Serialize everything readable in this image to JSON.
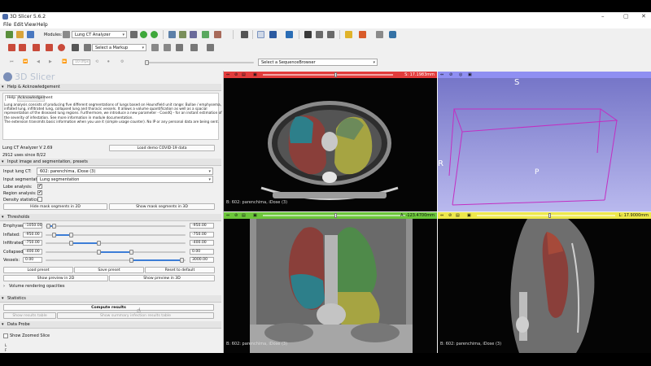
{
  "window": {
    "title": "3D Slicer 5.6.2",
    "controls": [
      "–",
      "▢",
      "✕"
    ]
  },
  "menu": [
    "File",
    "Edit",
    "View",
    "Help"
  ],
  "toolbar": {
    "modules_label": "Modules:",
    "module_selected": "Lung CT Analyzer",
    "markup_placeholder": "Select a Markup",
    "sequence_placeholder": "Select a SequenceBrowser",
    "fps": "10.0fps"
  },
  "logo_text": "3D Slicer",
  "help": {
    "section_title": "Help & Acknowledgement",
    "tabs": [
      "Help",
      "Acknowledgement"
    ],
    "text_lines": [
      "Lung analysis consists of producing five different segmentations of lungs based on Hounsfield unit range: Bullae / emphysema,",
      "inflated lung, infiltrated lung, collapsed lung and thoracic vessels. It allows a volume quantification as well as a spacial",
      "representation of the diseased lung regions. Furthermore, we introduce a new parameter - CovidQ - for an instant estimation of",
      "the severity of infestation. See more information in module documentation.",
      "The extension transmits basic information when you use it (simple usage counter). No IP or any personal data are being sent."
    ],
    "doc_link": "module documentation"
  },
  "version": "Lung CT Analyzer V 2.69",
  "load_demo_button": "Load demo COVID-19 data",
  "uses": "2912 uses since 8/22",
  "input_section": {
    "title": "Input image and segmentation, presets",
    "input_lung_ct_label": "Input lung CT:",
    "input_lung_ct_value": "602: parenchima, iDose (3)",
    "input_seg_label": "Input segmentation:",
    "input_seg_value": "Lung segmentation",
    "lobe_label": "Lobe analysis:",
    "region_label": "Region analysis:",
    "density_label": "Density statistics:",
    "lobe_checked": "✔",
    "region_checked": "✔",
    "hide_button": "Hide mask segments in 2D",
    "show3d_button": "Show mask segments in 3D"
  },
  "thresholds": {
    "title": "Thresholds",
    "rows": [
      {
        "label": "Emphysema:",
        "min": "-1050.00",
        "max": "-950.00",
        "range": [
          0.02,
          0.06
        ]
      },
      {
        "label": "Inflated:",
        "min": "-950.00",
        "max": "-750.00",
        "range": [
          0.06,
          0.18
        ]
      },
      {
        "label": "Infiltrated:",
        "min": "-750.00",
        "max": "-400.00",
        "range": [
          0.18,
          0.38
        ]
      },
      {
        "label": "Collapsed:",
        "min": "-400.00",
        "max": "0.00",
        "range": [
          0.38,
          0.61
        ]
      },
      {
        "label": "Vessels:",
        "min": "0.00",
        "max": "3000.00",
        "range": [
          0.61,
          0.97
        ]
      }
    ],
    "load_preset": "Load preset",
    "save_preset": "Save preset",
    "reset_default": "Reset to default",
    "preview2d": "Show preview in 2D",
    "preview3d": "Show preview in 3D"
  },
  "volume_rendering": "Volume rendering opacities",
  "statistics": {
    "title": "Statistics",
    "compute": "Compute results",
    "show_table": "Show results table",
    "show_summary": "Show summary infection results table"
  },
  "data_probe": {
    "title": "Data Probe",
    "zoomed": "Show Zoomed Slice",
    "probe_l": "L",
    "probe_f": "F",
    "probe_b": "B"
  },
  "views": {
    "red": {
      "color": "#e23c3c",
      "value": "S: 17.1983mm",
      "corner": "B: 602: parenchima, iDose (3)"
    },
    "threed": {
      "color": "#8f8ff2",
      "letters": [
        "S",
        "R",
        "P"
      ]
    },
    "green": {
      "color": "#6cc63a",
      "value": "A: -123.4700mm",
      "corner": "B: 602: parenchima, iDose (3)"
    },
    "yellow": {
      "color": "#ede84b",
      "value": "L: 17.9000mm",
      "corner": "B: 602: parenchima, iDose (3)"
    }
  }
}
